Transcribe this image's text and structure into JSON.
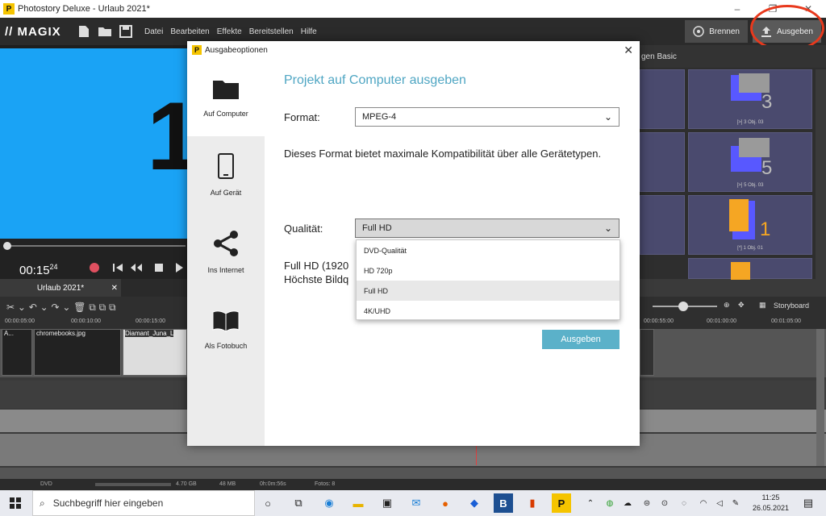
{
  "window": {
    "title": "Photostory Deluxe - Urlaub 2021*",
    "controls": [
      "–",
      "❐",
      "✕"
    ]
  },
  "menubar": {
    "logo": "// MAGIX",
    "items": [
      "Datei",
      "Bearbeiten",
      "Effekte",
      "Bereitstellen",
      "Hilfe"
    ],
    "burn_label": "Brennen",
    "export_label": "Ausgeben"
  },
  "preview": {
    "big_text": "1",
    "timecode": "00:15",
    "frames": "24"
  },
  "right_panel": {
    "header": "gen Basic",
    "tiles": [
      "[>] 3 Obj. 03",
      "[>] 5 Obj. 03",
      "[*] 1 Obj. 01"
    ],
    "tile_numbers": [
      "3",
      "5",
      "1"
    ],
    "storyboard_label": "Storyboard"
  },
  "timeline": {
    "tab": "Urlaub 2021*",
    "ruler": [
      "00:00:05:00",
      "00:00:10:00",
      "00:00:15:00",
      "00:00:55:00",
      "00:01:00:00",
      "00:01:05:00"
    ],
    "clips": [
      "A...",
      "chromebooks.jpg",
      "Diamant_Juna_L"
    ]
  },
  "status": {
    "disc": "DVD",
    "size": "4.70 GB",
    "used": "48 MB",
    "duration": "0h:0m:56s",
    "photos": "Fotos: 8"
  },
  "taskbar": {
    "search_placeholder": "Suchbegriff hier eingeben",
    "time": "11:25",
    "date": "26.05.2021"
  },
  "dialog": {
    "title": "Ausgabeoptionen",
    "close": "✕",
    "nav": [
      {
        "label": "Auf Computer",
        "icon": "folder-icon"
      },
      {
        "label": "Auf Gerät",
        "icon": "phone-icon"
      },
      {
        "label": "Ins Internet",
        "icon": "share-icon"
      },
      {
        "label": "Als Fotobuch",
        "icon": "book-icon"
      }
    ],
    "heading": "Projekt auf Computer ausgeben",
    "format_label": "Format:",
    "format_value": "MPEG-4",
    "format_desc": "Dieses Format bietet maximale Kompatibilität über alle Gerätetypen.",
    "quality_label": "Qualität:",
    "quality_value": "Full HD",
    "quality_options": [
      "DVD-Qualität",
      "HD 720p",
      "Full HD",
      "4K/UHD"
    ],
    "quality_desc_line1": "Full HD (1920",
    "quality_desc_line2": "Höchste Bildq",
    "submit_label": "Ausgeben",
    "accent": "#4fa6c3"
  }
}
